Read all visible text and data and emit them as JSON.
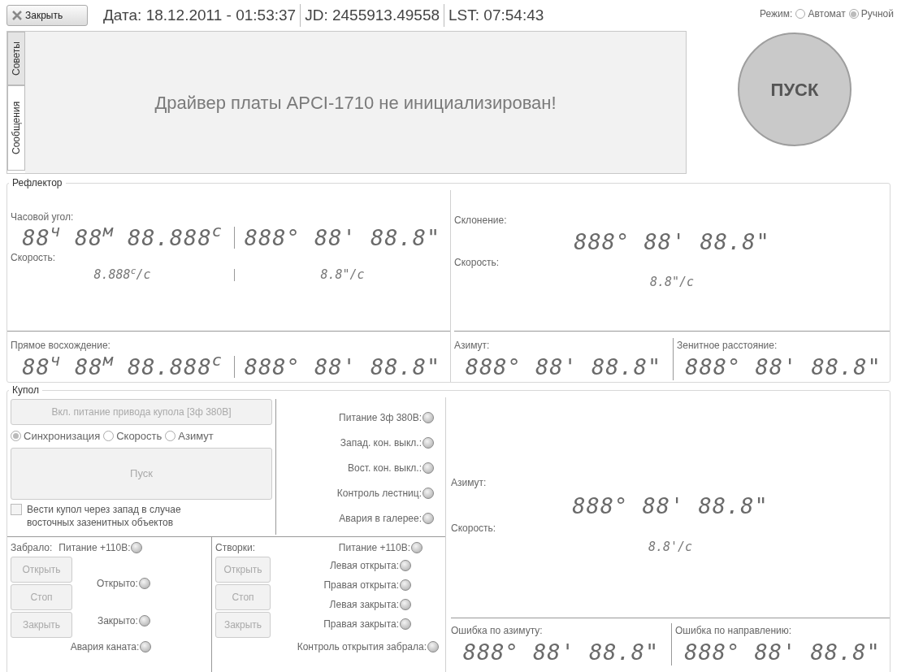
{
  "close_button": {
    "label": "Закрыть"
  },
  "header": [
    "Дата: 18.12.2011 - 01:53:37",
    "JD: 2455913.49558",
    "LST: 07:54:43"
  ],
  "mode": {
    "label": "Режим:",
    "options": [
      {
        "label": "Автомат",
        "selected": false
      },
      {
        "label": "Ручной",
        "selected": true
      }
    ]
  },
  "message_tabs": [
    {
      "label": "Советы",
      "selected": false
    },
    {
      "label": "Сообщения",
      "selected": true
    }
  ],
  "message": "Драйвер платы APCI-1710 не инициализирован!",
  "start_button": {
    "label": "ПУСК"
  },
  "reflector": {
    "title": "Рефлектор",
    "hour_angle": {
      "label": "Часовой угол:",
      "time": "88$^{ч}$ 88$^{м}$ 88.888$^{с}$",
      "angle": "888° 88' 88.8\""
    },
    "speed": {
      "label": "Скорость:",
      "time": "8.888$^{с}$/с",
      "angle": "8.8\"/с"
    },
    "right_ascension": {
      "label": "Прямое восхождение:",
      "time": "88$^{ч}$ 88$^{м}$ 88.888$^{с}$",
      "angle": "888° 88' 88.8\""
    },
    "declination": {
      "label": "Склонение:",
      "value": "888° 88' 88.8\""
    },
    "declination_speed": {
      "label": "Скорость:",
      "value": "8.8\"/с"
    },
    "azimuth": {
      "label": "Азимут:",
      "value": "888° 88' 88.8\""
    },
    "zenith_distance": {
      "label": "Зенитное расстояние:",
      "value": "888° 88' 88.8\""
    }
  },
  "dome": {
    "title": "Купол",
    "power_button": {
      "label": "Вкл. питание привода купола [3ф 380В]",
      "disabled": true
    },
    "modes": [
      {
        "label": "Синхронизация",
        "selected": true
      },
      {
        "label": "Скорость",
        "selected": false
      },
      {
        "label": "Азимут",
        "selected": false
      }
    ],
    "start_button": {
      "label": "Пуск",
      "disabled": true
    },
    "west_checkbox": {
      "label": "Вести купол через запад в случае восточных зазенитных объектов",
      "checked": false
    },
    "indicators": [
      {
        "label": "Питание 3ф 380В:",
        "on": false
      },
      {
        "label": "Запад. кон. выкл.:",
        "on": false
      },
      {
        "label": "Вост. кон. выкл.:",
        "on": false
      },
      {
        "label": "Контроль лестниц:",
        "on": false
      },
      {
        "label": "Авария в галерее:",
        "on": false
      }
    ],
    "visor": {
      "title": "Забрало:",
      "power": {
        "label": "Питание +110В:",
        "on": false
      },
      "buttons": [
        {
          "label": "Открыть",
          "disabled": true
        },
        {
          "label": "Стоп",
          "disabled": true
        },
        {
          "label": "Закрыть",
          "disabled": true
        }
      ],
      "indicators": [
        {
          "label": "Открыто:",
          "on": false
        },
        {
          "label": "Закрыто:",
          "on": false
        }
      ],
      "alarm": {
        "label": "Авария каната:",
        "on": false
      }
    },
    "flaps": {
      "title": "Створки:",
      "power": {
        "label": "Питание +110В:",
        "on": false
      },
      "buttons": [
        {
          "label": "Открыть",
          "disabled": true
        },
        {
          "label": "Стоп",
          "disabled": true
        },
        {
          "label": "Закрыть",
          "disabled": true
        }
      ],
      "indicators": [
        {
          "label": "Левая открыта:",
          "on": false
        },
        {
          "label": "Правая открыта:",
          "on": false
        },
        {
          "label": "Левая закрыта:",
          "on": false
        },
        {
          "label": "Правая закрыта:",
          "on": false
        }
      ],
      "alarm": {
        "label": "Контроль открытия забрала:",
        "on": false
      }
    },
    "azimuth": {
      "label": "Азимут:",
      "value": "888° 88' 88.8\""
    },
    "speed": {
      "label": "Скорость:",
      "value": "8.8'/с"
    },
    "azimuth_error": {
      "label": "Ошибка по азимуту:",
      "value": "888° 88' 88.8\""
    },
    "direction_error": {
      "label": "Ошибка по направлению:",
      "value": "888° 88' 88.8\""
    }
  }
}
